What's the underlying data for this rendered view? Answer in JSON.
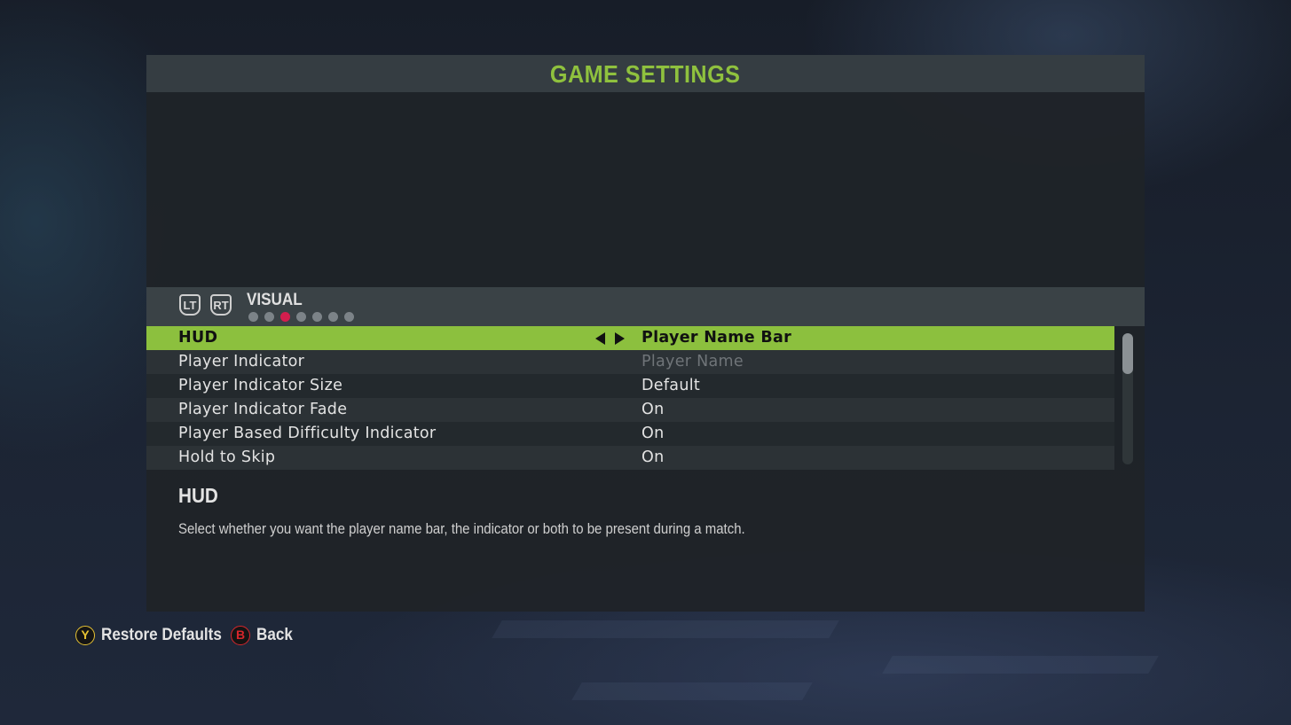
{
  "header": {
    "title": "GAME SETTINGS"
  },
  "tabs": {
    "prev_trigger": "LT",
    "next_trigger": "RT",
    "current_label": "VISUAL",
    "page_count": 7,
    "active_page": 3
  },
  "settings": [
    {
      "label": "HUD",
      "value": "Player Name Bar",
      "selected": true,
      "disabled": false
    },
    {
      "label": "Player Indicator",
      "value": "Player Name",
      "selected": false,
      "disabled": true
    },
    {
      "label": "Player Indicator Size",
      "value": "Default",
      "selected": false,
      "disabled": false
    },
    {
      "label": "Player Indicator Fade",
      "value": "On",
      "selected": false,
      "disabled": false
    },
    {
      "label": "Player Based Difficulty Indicator",
      "value": "On",
      "selected": false,
      "disabled": false
    },
    {
      "label": "Hold to Skip",
      "value": "On",
      "selected": false,
      "disabled": false
    }
  ],
  "description": {
    "title": "HUD",
    "text": "Select whether you want the player name bar, the indicator or both to be present during a match."
  },
  "footer": {
    "restore": {
      "glyph": "Y",
      "label": "Restore Defaults"
    },
    "back": {
      "glyph": "B",
      "label": "Back"
    }
  },
  "colors": {
    "accent": "#8cc03e",
    "title_text": "#8fc13e",
    "active_dot": "#d31e4e",
    "y_button": "#e6c232",
    "b_button": "#d8262b"
  }
}
